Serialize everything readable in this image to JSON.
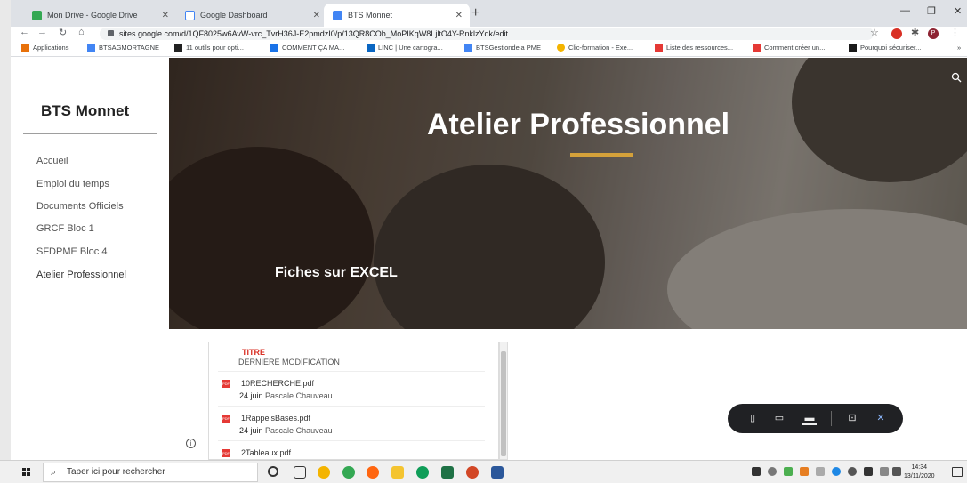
{
  "browser": {
    "tabs": [
      {
        "label": "Mon Drive - Google Drive",
        "color": "#34a853"
      },
      {
        "label": "Google Dashboard",
        "color": "#4285f4"
      },
      {
        "label": "BTS Monnet",
        "color": "#4285f4"
      }
    ],
    "url": "sites.google.com/d/1QF8025w6AvW-vrc_TvrH36J-E2pmdzI0/p/13QR8COb_MoPIKqW8LjltO4Y-RnklzYdk/edit",
    "bookmarks": [
      "Applications",
      "BTSAGMORTAGNE",
      "11 outils pour opti...",
      "COMMENT ÇA MA...",
      "LINC | Une cartogra...",
      "BTSGestiondela PME",
      "Clic-formation - Exe...",
      "Liste des ressources...",
      "Comment créer un...",
      "Pourquoi sécuriser..."
    ],
    "profile_initial": "P"
  },
  "site": {
    "title": "BTS Monnet",
    "nav": [
      "Accueil",
      "Emploi du temps",
      "Documents Officiels",
      "GRCF Bloc 1",
      "SFDPME Bloc 4",
      "Atelier Professionnel"
    ],
    "hero_title": "Atelier Professionnel",
    "hero_subtitle": "Fiches sur EXCEL",
    "accent_color": "#d4a13a"
  },
  "files": {
    "header_title": "TITRE",
    "header_modified": "DERNIÈRE MODIFICATION",
    "items": [
      {
        "name": "10RECHERCHE.pdf",
        "date": "24 juin",
        "author": "Pascale Chauveau"
      },
      {
        "name": "1RappelsBases.pdf",
        "date": "24 juin",
        "author": "Pascale Chauveau"
      },
      {
        "name": "2Tableaux.pdf",
        "date": "",
        "author": ""
      }
    ]
  },
  "taskbar": {
    "search_placeholder": "Taper ici pour rechercher",
    "time": "14:34",
    "date": "13/11/2020"
  }
}
